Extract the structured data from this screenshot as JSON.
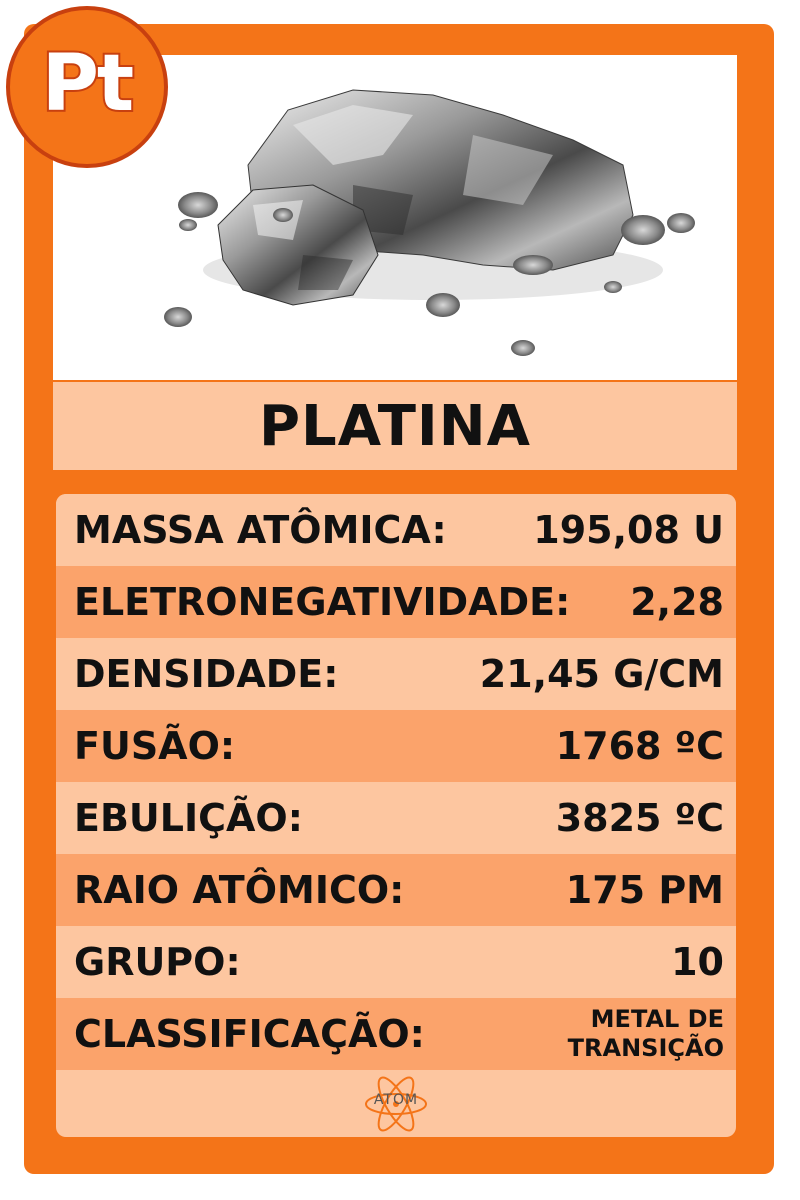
{
  "card": {
    "symbol": "Pt",
    "name": "PLATINA",
    "photo": "platinum-nuggets"
  },
  "stats": [
    {
      "label": "MASSA ATÔMICA:",
      "value": "195,08 U"
    },
    {
      "label": "ELETRONEGATIVIDADE:",
      "value": "2,28"
    },
    {
      "label": "DENSIDADE:",
      "value": "21,45 G/CM"
    },
    {
      "label": "FUSÃO:",
      "value": "1768 ºC"
    },
    {
      "label": "EBULIÇÃO:",
      "value": "3825 ºC"
    },
    {
      "label": "RAIO ATÔMICO:",
      "value": "175 PM"
    },
    {
      "label": "GRUPO:",
      "value": "10"
    },
    {
      "label": "CLASSIFICAÇÃO:",
      "value": "METAL DE\nTRANSIÇÃO"
    }
  ],
  "footer": {
    "logo_text": "ATOM"
  },
  "colors": {
    "card_orange": "#f47418",
    "badge_border": "#c8400f",
    "row_light": "#fdc6a0",
    "row_dark": "#fba36b",
    "text": "#111111"
  }
}
